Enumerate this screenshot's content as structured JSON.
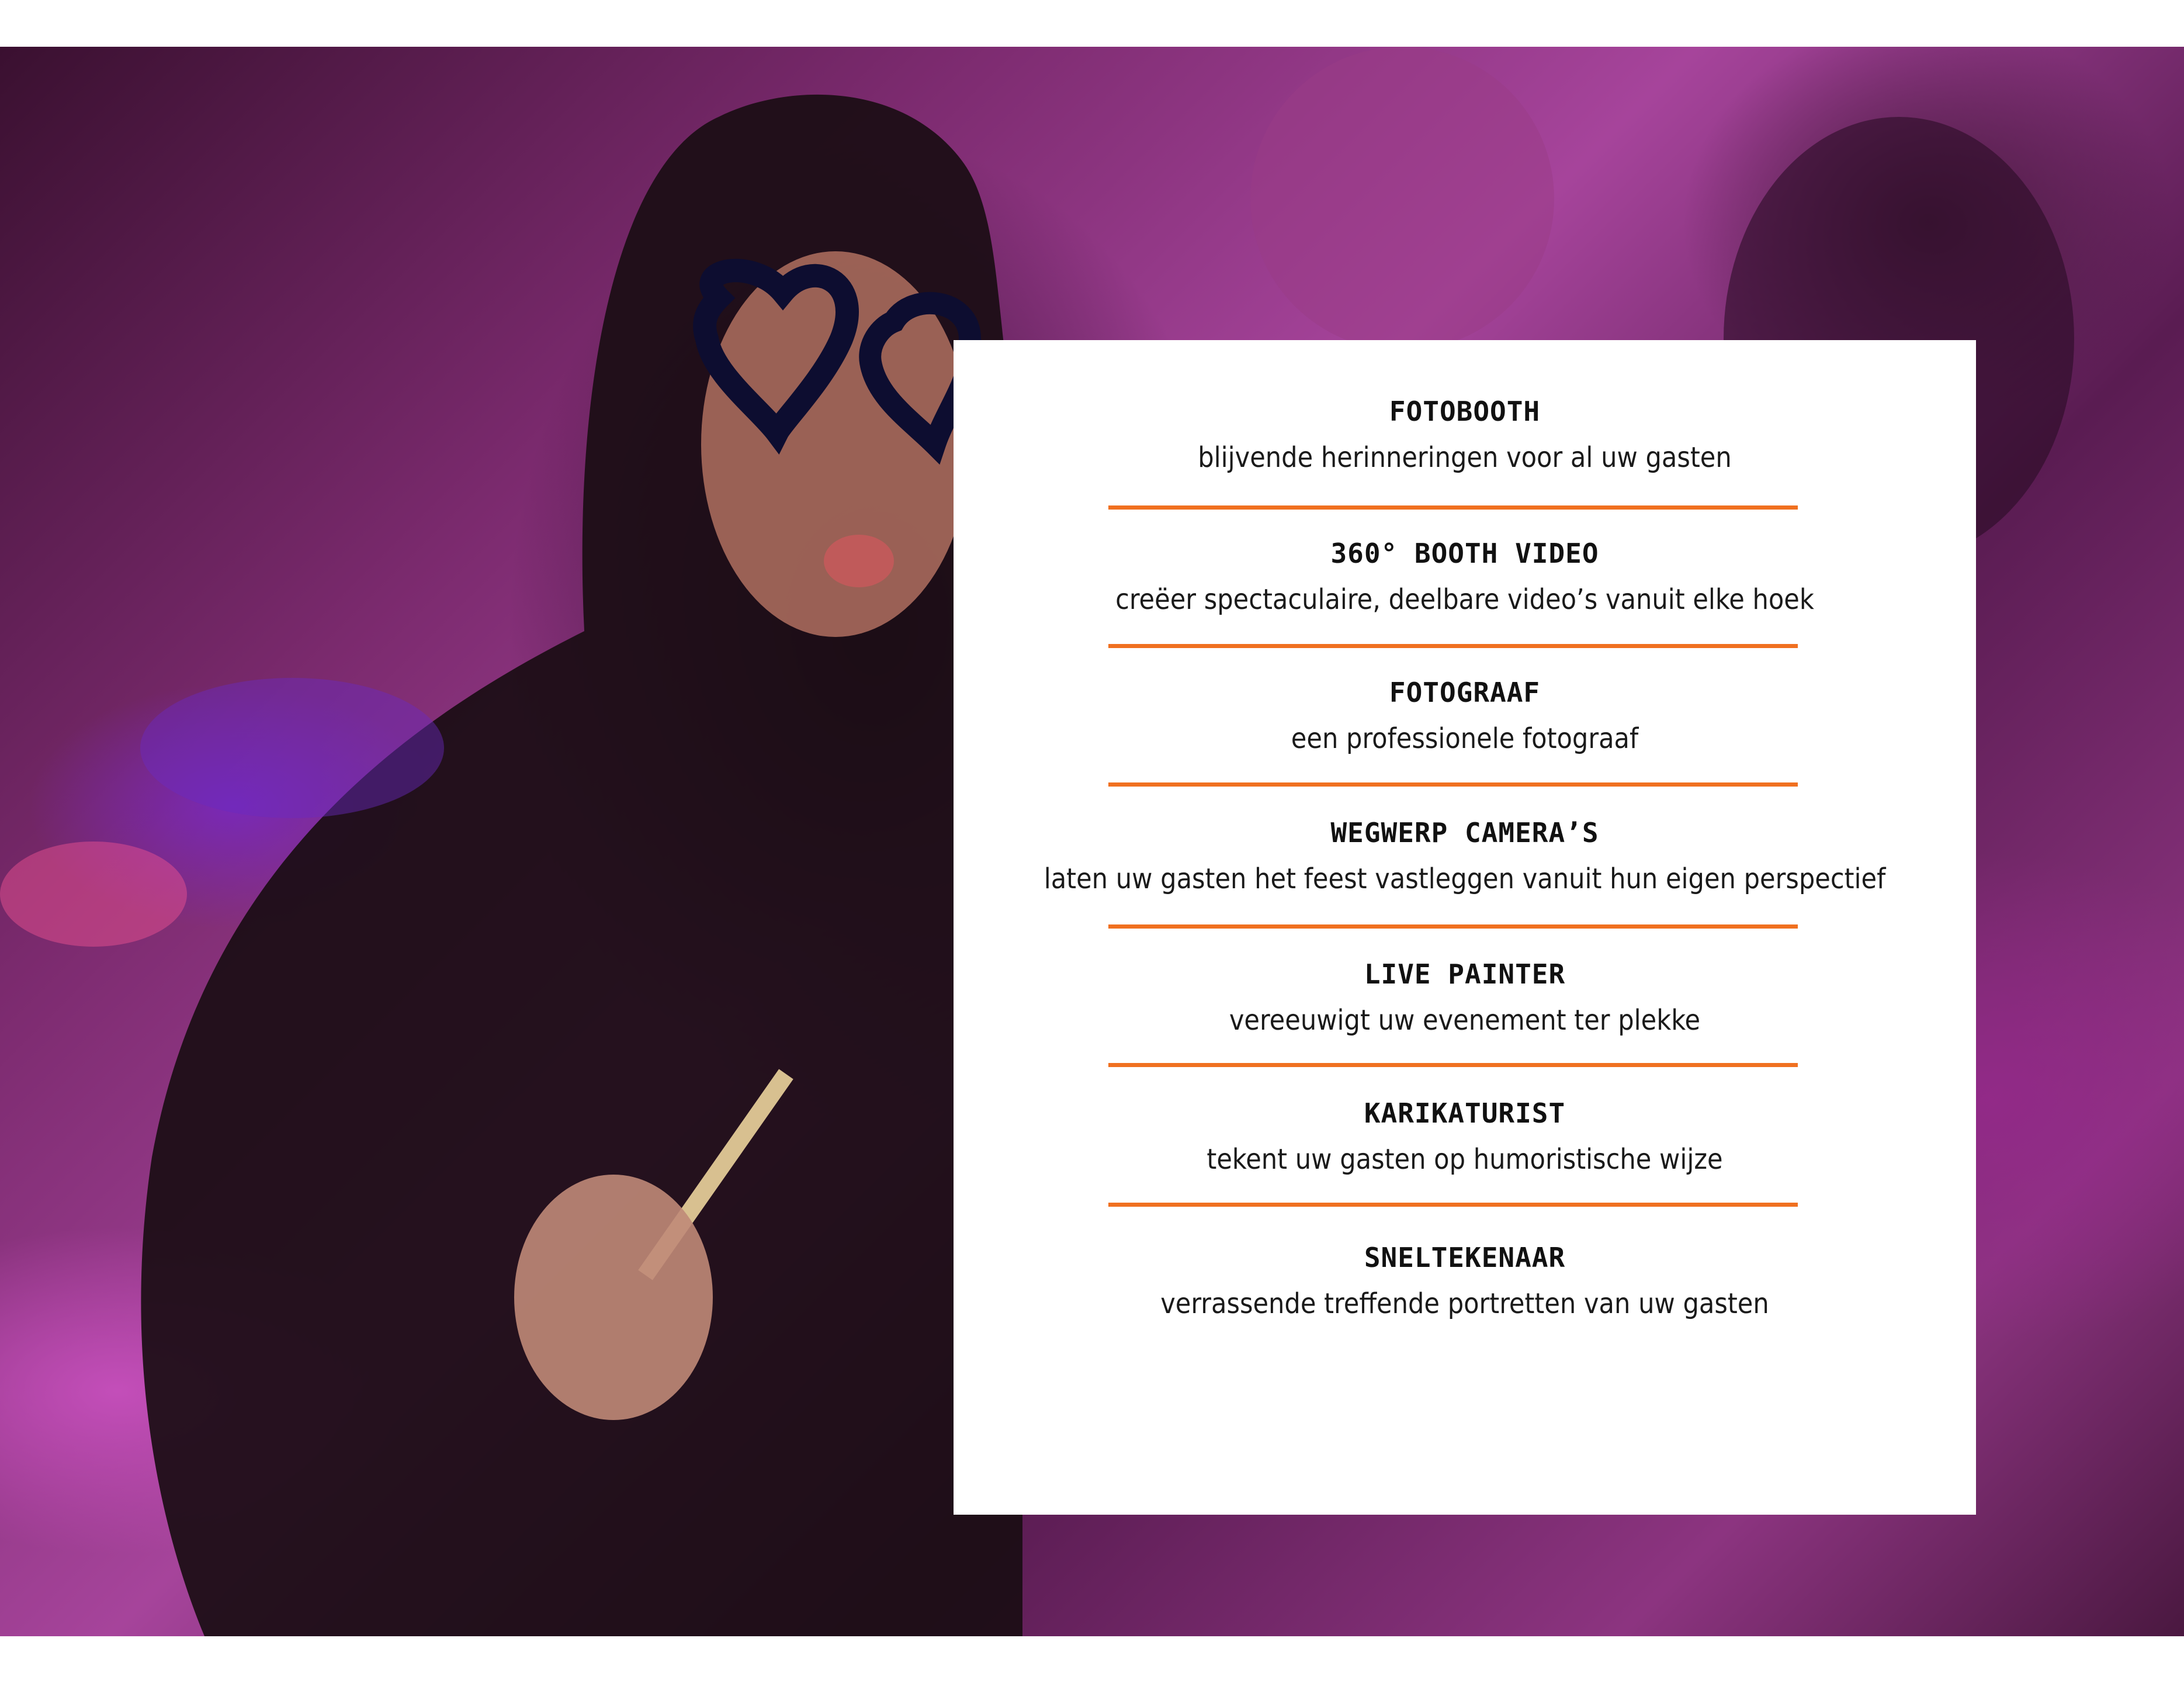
{
  "colors": {
    "accent": "#f07020",
    "card_background": "#ffffff",
    "text": "#111111"
  },
  "background_image": {
    "icon": "party-photo"
  },
  "services": [
    {
      "title": "FOTOBOOTH",
      "description": "blijvende herinneringen voor al uw gasten"
    },
    {
      "title": "360° BOOTH VIDEO",
      "description": "creëer spectaculaire, deelbare video’s vanuit elke hoek"
    },
    {
      "title": "FOTOGRAAF",
      "description": "een professionele fotograaf"
    },
    {
      "title": "WEGWERP CAMERA’S",
      "description": "laten uw gasten het feest vastleggen vanuit hun eigen perspectief"
    },
    {
      "title": "LIVE PAINTER",
      "description": "vereeuwigt uw evenement ter plekke"
    },
    {
      "title": "KARIKATURIST",
      "description": "tekent uw gasten op humoristische wijze"
    },
    {
      "title": "SNELTEKENAAR",
      "description": "verrassende treffende portretten van uw gasten"
    }
  ]
}
